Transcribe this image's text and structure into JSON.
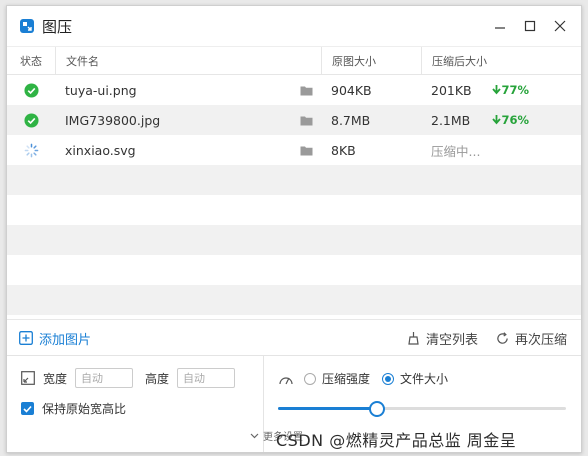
{
  "app": {
    "title": "图压"
  },
  "columns": {
    "status": "状态",
    "name": "文件名",
    "original": "原图大小",
    "compressed": "压缩后大小"
  },
  "files": [
    {
      "status": "done",
      "status_icon": "check-circle-icon",
      "name": "tuya-ui.png",
      "original": "904KB",
      "compressed": "201KB",
      "percent": "77%"
    },
    {
      "status": "done",
      "status_icon": "check-circle-icon",
      "name": "IMG739800.jpg",
      "original": "8.7MB",
      "compressed": "2.1MB",
      "percent": "76%"
    },
    {
      "status": "loading",
      "status_icon": "spinner-icon",
      "name": "xinxiao.svg",
      "original": "8KB",
      "compressed": "压缩中...",
      "percent": ""
    }
  ],
  "toolbar": {
    "add_label": "添加图片",
    "clear_label": "清空列表",
    "recompress_label": "再次压缩"
  },
  "settings": {
    "width_label": "宽度",
    "width_placeholder": "自动",
    "height_label": "高度",
    "height_placeholder": "自动",
    "keep_ratio_label": "保持原始宽高比",
    "keep_ratio_checked": true,
    "mode_strength_label": "压缩强度",
    "mode_size_label": "文件大小",
    "selected_mode": "文件大小",
    "slider_value": 0.34
  },
  "footer": {
    "hint": "更多设置"
  },
  "watermark": "CSDN @燃精灵产品总监   周金呈",
  "colors": {
    "accent": "#1a7fd4",
    "success": "#26a33a"
  }
}
